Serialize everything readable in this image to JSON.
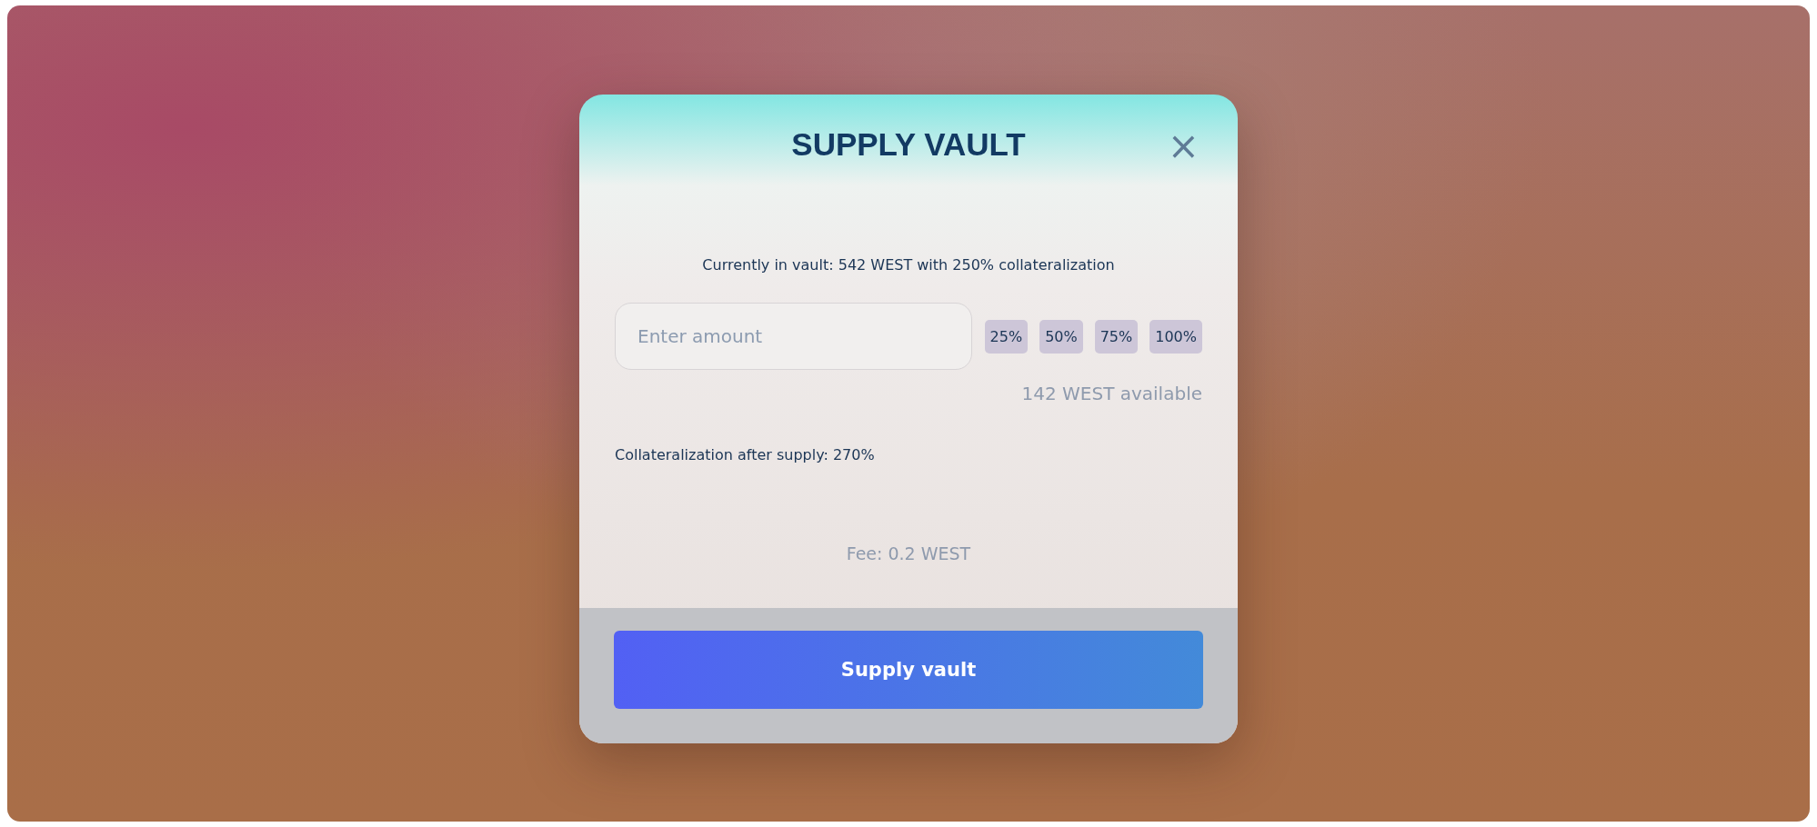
{
  "dialog": {
    "title": "SUPPLY VAULT",
    "close": "×"
  },
  "current_text": "Currently in vault: 542 WEST with 250% collateralization",
  "amount_field": {
    "placeholder": "Enter amount"
  },
  "percent_buttons": [
    "25%",
    "50%",
    "75%",
    "100%"
  ],
  "available": "142 WEST available",
  "collateral_after": "Collateralization after supply: 270%",
  "fee": "Fee: 0.2 WEST",
  "submit_button": "Supply vault"
}
